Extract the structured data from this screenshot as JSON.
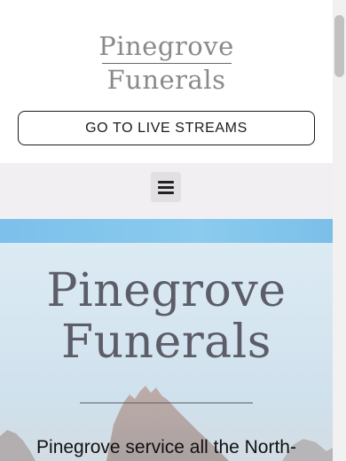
{
  "header": {
    "logo_line1": "Pinegrove",
    "logo_line2": "Funerals",
    "cta_label": "GO TO LIVE STREAMS"
  },
  "nav": {
    "menu_icon": "hamburger-menu-icon"
  },
  "hero": {
    "title_line1": "Pinegrove",
    "title_line2": "Funerals",
    "intro_text": "Pinegrove service all the North-"
  },
  "colors": {
    "nav_background": "#f1eff1",
    "hero_title": "#5c5d68",
    "sky_band": "#7cc0eb"
  }
}
